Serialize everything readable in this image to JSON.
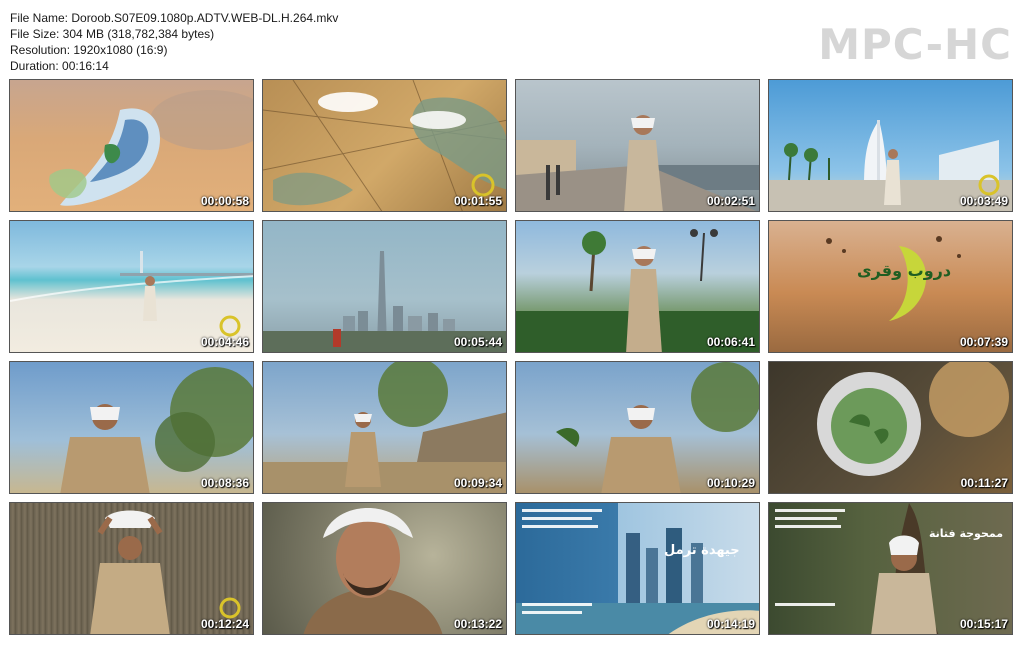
{
  "info": {
    "file_name": "File Name: Doroob.S07E09.1080p.ADTV.WEB-DL.H.264.mkv",
    "file_size": "File Size: 304 MB (318,782,384 bytes)",
    "resolution": "Resolution: 1920x1080 (16:9)",
    "duration": "Duration: 00:16:14"
  },
  "logo": "MPC-HC",
  "thumbnails": [
    {
      "time": "00:00:58",
      "scene": "desert-intro",
      "bg": "#d9a878"
    },
    {
      "time": "00:01:55",
      "scene": "map",
      "bg": "#c79a55"
    },
    {
      "time": "00:02:51",
      "scene": "waterfront-host",
      "bg": "#a8b6bf"
    },
    {
      "time": "00:03:49",
      "scene": "burj-al-arab",
      "bg": "#6faed8"
    },
    {
      "time": "00:04:46",
      "scene": "beach-walk",
      "bg": "#8fc4dd"
    },
    {
      "time": "00:05:44",
      "scene": "skyline",
      "bg": "#93b3c2"
    },
    {
      "time": "00:06:41",
      "scene": "park-host",
      "bg": "#6b8f5a"
    },
    {
      "time": "00:07:39",
      "scene": "logo-title",
      "bg": "#c98a54"
    },
    {
      "time": "00:08:36",
      "scene": "tree-host",
      "bg": "#7ea3c9"
    },
    {
      "time": "00:09:34",
      "scene": "tree-crouch",
      "bg": "#89a9c5"
    },
    {
      "time": "00:10:29",
      "scene": "tree-talk",
      "bg": "#86a7c4"
    },
    {
      "time": "00:11:27",
      "scene": "bowl-herbs",
      "bg": "#4a4232"
    },
    {
      "time": "00:12:24",
      "scene": "hut-host",
      "bg": "#6e6655"
    },
    {
      "time": "00:13:22",
      "scene": "closeup",
      "bg": "#8f8a77"
    },
    {
      "time": "00:14:19",
      "scene": "credits-city",
      "bg": "#3b6f9c"
    },
    {
      "time": "00:15:17",
      "scene": "credits-tree",
      "bg": "#4d5a3e"
    }
  ],
  "overlays": {
    "title_logo": "دروب وقرى",
    "credits_left": "جيهدة ترمل",
    "credits_right": "ممحوجة فتانة"
  }
}
